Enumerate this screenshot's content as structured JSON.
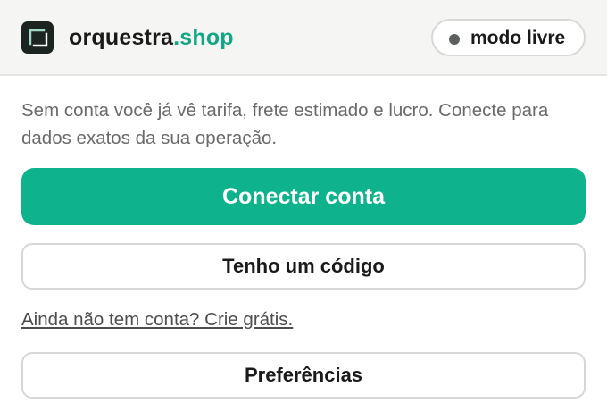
{
  "header": {
    "brand_name": "orquestra",
    "brand_tld": ".shop",
    "logo_icon": "bracket-logo-icon",
    "mode_label": "modo livre",
    "mode_dot_color": "#5b5f5d"
  },
  "intro": {
    "text": "Sem conta você já vê tarifa, frete estimado e lucro. Conecte para dados exatos da sua operação."
  },
  "actions": {
    "connect_label": "Conectar conta",
    "code_label": "Tenho um código",
    "signup_link": "Ainda não tem conta? Crie grátis.",
    "preferences_label": "Preferências"
  },
  "colors": {
    "accent": "#0eb38e",
    "brand_tld": "#12a784",
    "logo_bg": "#1c2421"
  }
}
